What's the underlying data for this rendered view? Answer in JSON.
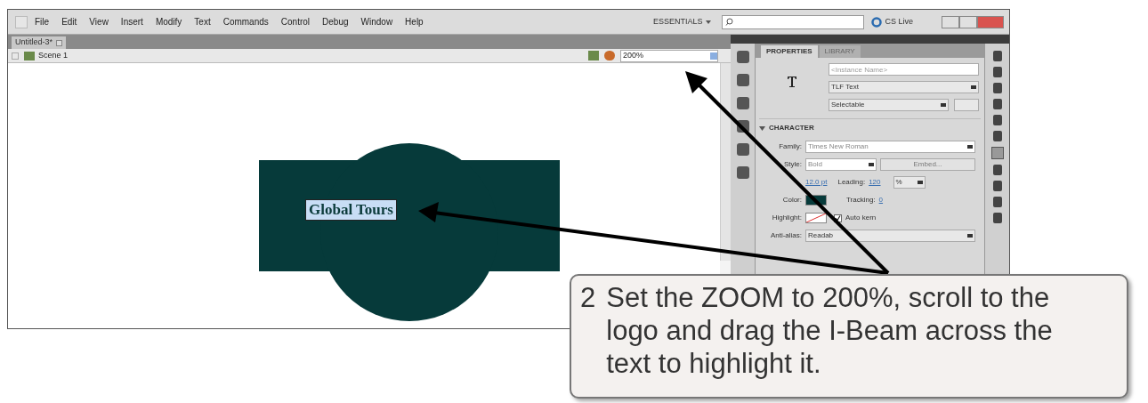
{
  "app_window": {
    "menu": [
      "File",
      "Edit",
      "View",
      "Insert",
      "Modify",
      "Text",
      "Commands",
      "Control",
      "Debug",
      "Window",
      "Help"
    ],
    "workspace": "ESSENTIALS",
    "cs_live": "CS Live"
  },
  "document_tab": {
    "title": "Untitled-3*"
  },
  "edit_bar": {
    "scene": "Scene 1",
    "zoom": "200%"
  },
  "stage": {
    "text": "Global Tours",
    "text_selected": true
  },
  "properties_panel": {
    "tabs": [
      {
        "label": "PROPERTIES",
        "selected": true
      },
      {
        "label": "LIBRARY",
        "selected": false
      }
    ],
    "instance_name": {
      "placeholder": "<Instance Name>"
    },
    "text_engine": "TLF Text",
    "text_type": "Selectable",
    "section": {
      "label": "CHARACTER",
      "expanded": true
    },
    "family": {
      "label": "Family:",
      "value": "Times New Roman"
    },
    "style": {
      "label": "Style:",
      "value": "Bold"
    },
    "embed_button": "Embed...",
    "size_value": "12.0 pt",
    "leading": {
      "label": "Leading:",
      "value": "120",
      "unit": "%"
    },
    "color_label": "Color:",
    "tracking": {
      "label": "Tracking:",
      "value": "0"
    },
    "highlight_label": "Highlight:",
    "auto_kern": {
      "label": "Auto kern",
      "checked": true
    },
    "anti_alias": {
      "label": "Anti-alias:",
      "value": "Readab"
    }
  },
  "callout": {
    "step": "2",
    "text": "Set the ZOOM to 200%, scroll to the logo and drag the I-Beam across the text to highlight it."
  }
}
